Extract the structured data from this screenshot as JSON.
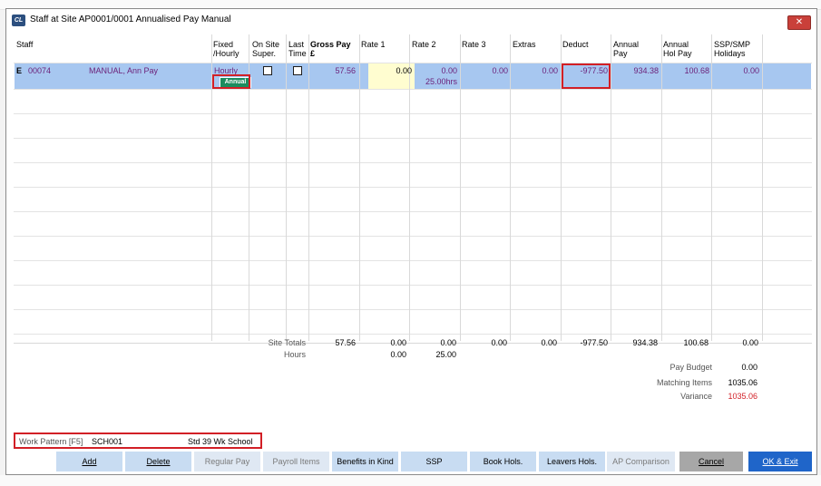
{
  "window": {
    "title": "Staff at Site AP0001/0001 Annualised Pay Manual",
    "icon": "cl-app-icon",
    "close_glyph": "✕"
  },
  "columns": {
    "staff": "Staff",
    "fixed_hourly_1": "Fixed",
    "fixed_hourly_2": "/Hourly",
    "onsite_1": "On Site",
    "onsite_2": "Super.",
    "last_1": "Last",
    "last_2": "Time",
    "gross_1": "Gross  Pay",
    "gross_2": "£",
    "rate1": "Rate 1",
    "rate2": "Rate 2",
    "rate3": "Rate 3",
    "extras": "Extras",
    "deduct": "Deduct",
    "annual_pay_1": "Annual",
    "annual_pay_2": "Pay",
    "annual_hol_1": "Annual",
    "annual_hol_2": "Hol Pay",
    "ssp_1": "SSP/SMP",
    "ssp_2": "Holidays"
  },
  "rows": [
    {
      "marker": "E",
      "staff_no": "00074",
      "name": "MANUAL, Ann Pay",
      "fixed_hourly": "Hourly",
      "badge": "Annual",
      "onsite_super": false,
      "last_time": false,
      "gross_pay": "57.56",
      "rate1": "0.00",
      "rate2": "0.00",
      "rate2_hours": "25.00hrs",
      "rate3": "0.00",
      "extras": "0.00",
      "deduct": "-977.50",
      "annual_pay": "934.38",
      "annual_hol_pay": "100.68",
      "ssp_holidays": "0.00"
    }
  ],
  "totals": {
    "site_totals_label": "Site Totals",
    "hours_label": "Hours",
    "gross": "57.56",
    "rate1": "0.00",
    "rate2": "0.00",
    "rate3": "0.00",
    "extras": "0.00",
    "deduct": "-977.50",
    "annual_pay": "934.38",
    "annual_hol": "100.68",
    "ssp": "0.00",
    "hours_rate1": "0.00",
    "hours_rate2": "25.00"
  },
  "summary": {
    "pay_budget_label": "Pay Budget",
    "pay_budget": "0.00",
    "matching_items_label": "Matching Items",
    "matching_items": "1035.06",
    "variance_label": "Variance",
    "variance": "1035.06",
    "variance_color": "#d21f26"
  },
  "work_pattern": {
    "label": "Work Pattern [F5]",
    "code": "SCH001",
    "description": "Std 39 Wk School"
  },
  "buttons": {
    "add": "Add",
    "delete": "Delete",
    "regular_pay": "Regular Pay",
    "payroll_items": "Payroll Items",
    "benefits": "Benefits in Kind",
    "ssp": "SSP",
    "book_hols": "Book Hols.",
    "leavers_hols": "Leavers Hols.",
    "ap_comparison": "AP Comparison",
    "cancel": "Cancel",
    "ok_exit": "OK & Exit"
  }
}
